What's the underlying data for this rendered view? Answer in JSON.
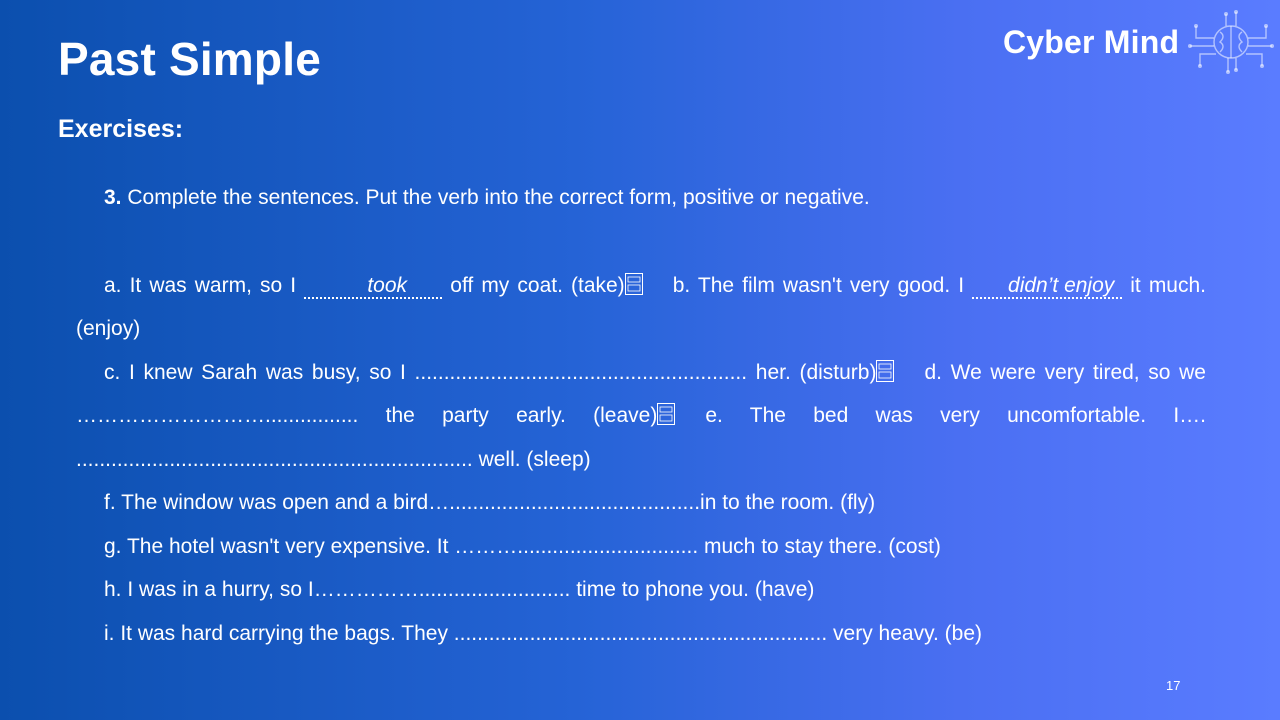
{
  "slide": {
    "title": "Past Simple",
    "subtitle": "Exercises:",
    "logo_text": "Cyber Mind",
    "page_number": "17"
  },
  "exercise": {
    "number": "3.",
    "instruction": " Complete the sentences. Put the verb into the correct form, positive or negative.",
    "a_pre": "a. It was warm, so I ",
    "a_ans": "took",
    "a_post": " off my coat. (take)",
    "b_pre": "b. The film wasn't very good. I ",
    "b_ans": "didn’t enjoy",
    "b_post": " it much. (enjoy)",
    "c": "c. I knew Sarah was busy, so I ......................................................... her. (disturb)",
    "d": "d. We were very tired, so we ………………………................ the party early. (leave)",
    "e": "e. The bed was very uncomfortable. I…. .................................................................... well. (sleep)",
    "f": "f. The window was open and a bird…...........................................in to the room. (fly)",
    "g": "g. The hotel wasn't very expensive. It ………............................... much to stay there. (cost)",
    "h": "h. I was in a hurry, so I…………….......................... time to phone you. (have)",
    "i": "i. It was hard carrying the bags. They ................................................................ very heavy. (be)"
  },
  "colors": {
    "background_start": "#0b4fae",
    "background_end": "#5a7cff",
    "text": "#ffffff"
  },
  "icons": [
    "brain-circuit-icon",
    "section-separator-icon"
  ]
}
